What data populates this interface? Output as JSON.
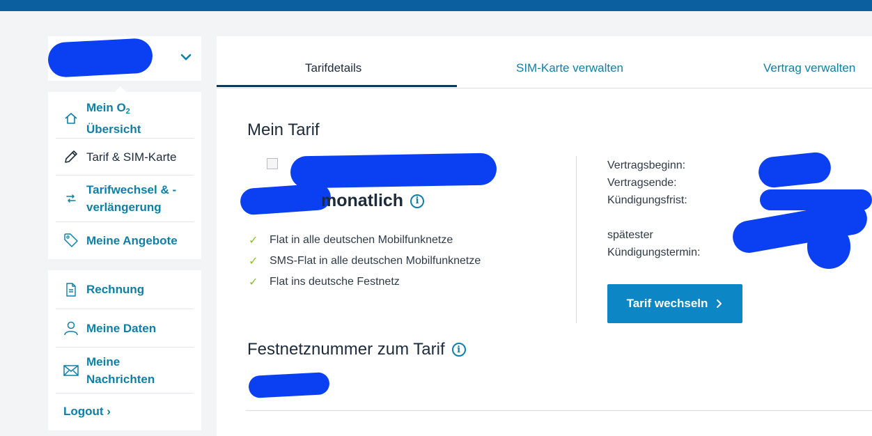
{
  "account": {
    "name_redacted": ""
  },
  "sidebar": {
    "items": [
      {
        "icon": "home-icon",
        "label_main": "Mein O",
        "label_sub": "2",
        "label_line2": "Übersicht"
      },
      {
        "icon": "pencil-icon",
        "label": "Tarif & SIM-Karte"
      },
      {
        "icon": "swap-arrows-icon",
        "label_line1": "Tarifwechsel & -",
        "label_line2": "verlängerung"
      },
      {
        "icon": "tag-icon",
        "label": "Meine Angebote"
      }
    ],
    "items2": [
      {
        "icon": "document-icon",
        "label": "Rechnung"
      },
      {
        "icon": "user-icon",
        "label": "Meine Daten"
      },
      {
        "icon": "mail-icon",
        "label_line1": "Meine",
        "label_line2": "Nachrichten"
      }
    ],
    "logout": "Logout ›"
  },
  "tabs": [
    {
      "label": "Tarifdetails",
      "active": true
    },
    {
      "label": "SIM-Karte verwalten",
      "active": false
    },
    {
      "label": "Vertrag verwalten",
      "active": false
    }
  ],
  "tariff": {
    "heading": "Mein Tarif",
    "monthly_label": "monatlich",
    "features": [
      "Flat in alle deutschen Mobilfunknetze",
      "SMS-Flat in alle deutschen Mobilfunknetze",
      "Flat ins deutsche Festnetz"
    ],
    "contract": {
      "start_label": "Vertragsbeginn:",
      "end_label": "Vertragsende:",
      "notice_label": "Kündigungsfrist:",
      "latest_label_line1": "spätester",
      "latest_label_line2": "Kündigungstermin:"
    },
    "change_button": "Tarif wechseln"
  },
  "landline": {
    "heading": "Festnetznummer zum Tarif"
  },
  "colors": {
    "accent": "#0e7fa6",
    "button": "#0c86c5",
    "check": "#8bbf2c",
    "topbar": "#0b5f9e",
    "redaction": "#0a3ff2"
  }
}
